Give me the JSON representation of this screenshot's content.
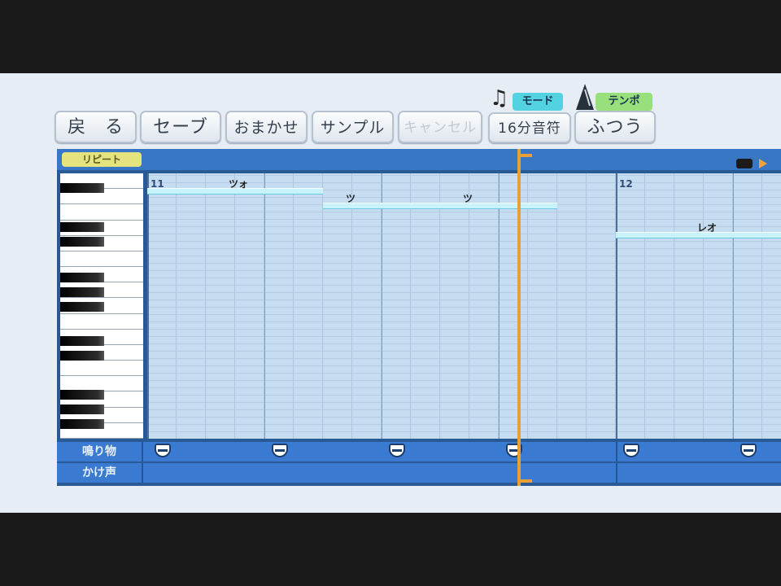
{
  "toolbar": {
    "back": "戻　る",
    "save": "セーブ",
    "omakase": "おまかせ",
    "sample": "サンプル",
    "cancel": "キャンセル",
    "mode_label": "モード",
    "mode_value": "16分音符",
    "tempo_label": "テンポ",
    "tempo_value": "ふつう"
  },
  "editor": {
    "repeat_label": "リピート",
    "measures": [
      {
        "number": "11",
        "notes": [
          {
            "syllable": "ツォ",
            "start_step": 0,
            "length": 6,
            "row": 2
          },
          {
            "syllable": "ツ",
            "start_step": 6,
            "length": 2,
            "row": 4
          },
          {
            "syllable": "ツ",
            "start_step": 8,
            "length": 6,
            "row": 4
          }
        ]
      },
      {
        "number": "12",
        "notes": [
          {
            "syllable": "レオ",
            "start_step": 0,
            "length": 6,
            "row": 8
          }
        ]
      }
    ],
    "rows": {
      "sound": "鳴り物",
      "voice": "かけ声"
    }
  },
  "colors": {
    "background": "#e6edf4",
    "header": "#3777c4",
    "grid": "#c6dcf0",
    "note": "#c8f3fb",
    "playhead": "#e8a033",
    "mode_badge": "#53d2e2",
    "tempo_badge": "#97e07c"
  },
  "icons": [
    "music-note-icon",
    "metronome-icon",
    "drum-icon",
    "end-marker-icon",
    "play-triangle-icon"
  ]
}
